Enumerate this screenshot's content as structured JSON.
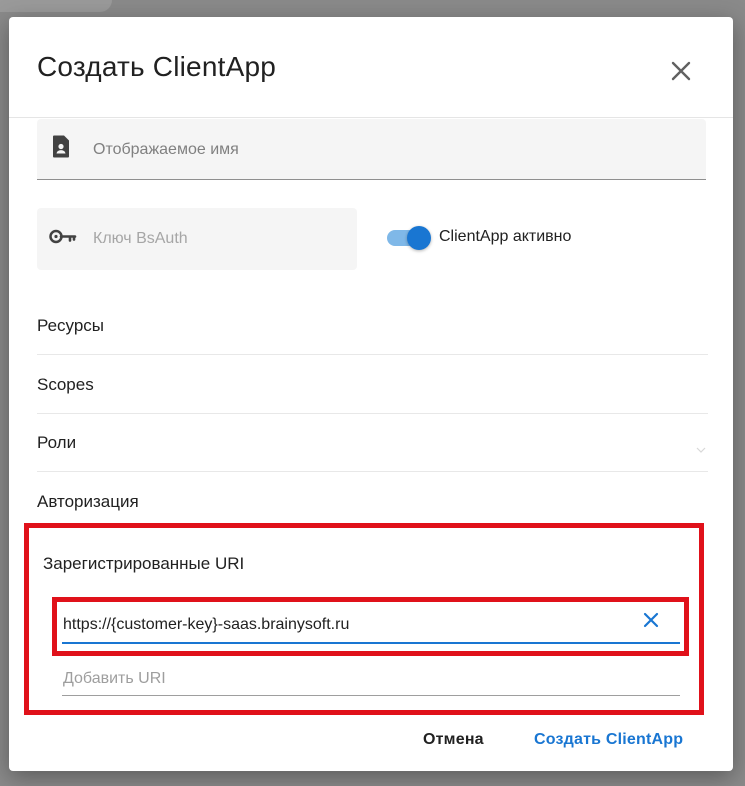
{
  "dialog": {
    "title": "Создать ClientApp",
    "close_icon": "close-icon"
  },
  "fields": {
    "display_name_placeholder": "Отображаемое имя",
    "display_name_icon": "contact-card-icon",
    "key_placeholder": "Ключ BsAuth",
    "key_icon": "key-icon"
  },
  "toggle": {
    "label": "ClientApp активно",
    "checked": true,
    "color": "#1976d2"
  },
  "sections": [
    {
      "label": "Ресурсы"
    },
    {
      "label": "Scopes"
    },
    {
      "label": "Роли"
    },
    {
      "label": "Авторизация"
    }
  ],
  "uris": {
    "heading": "Зарегистрированные URI",
    "items": [
      "https://{customer-key}-saas.brainysoft.ru"
    ],
    "add_placeholder": "Добавить URI"
  },
  "footer": {
    "cancel_label": "Отмена",
    "create_label": "Создать ClientApp"
  },
  "colors": {
    "accent": "#1976d2",
    "highlight": "#e0111a"
  }
}
